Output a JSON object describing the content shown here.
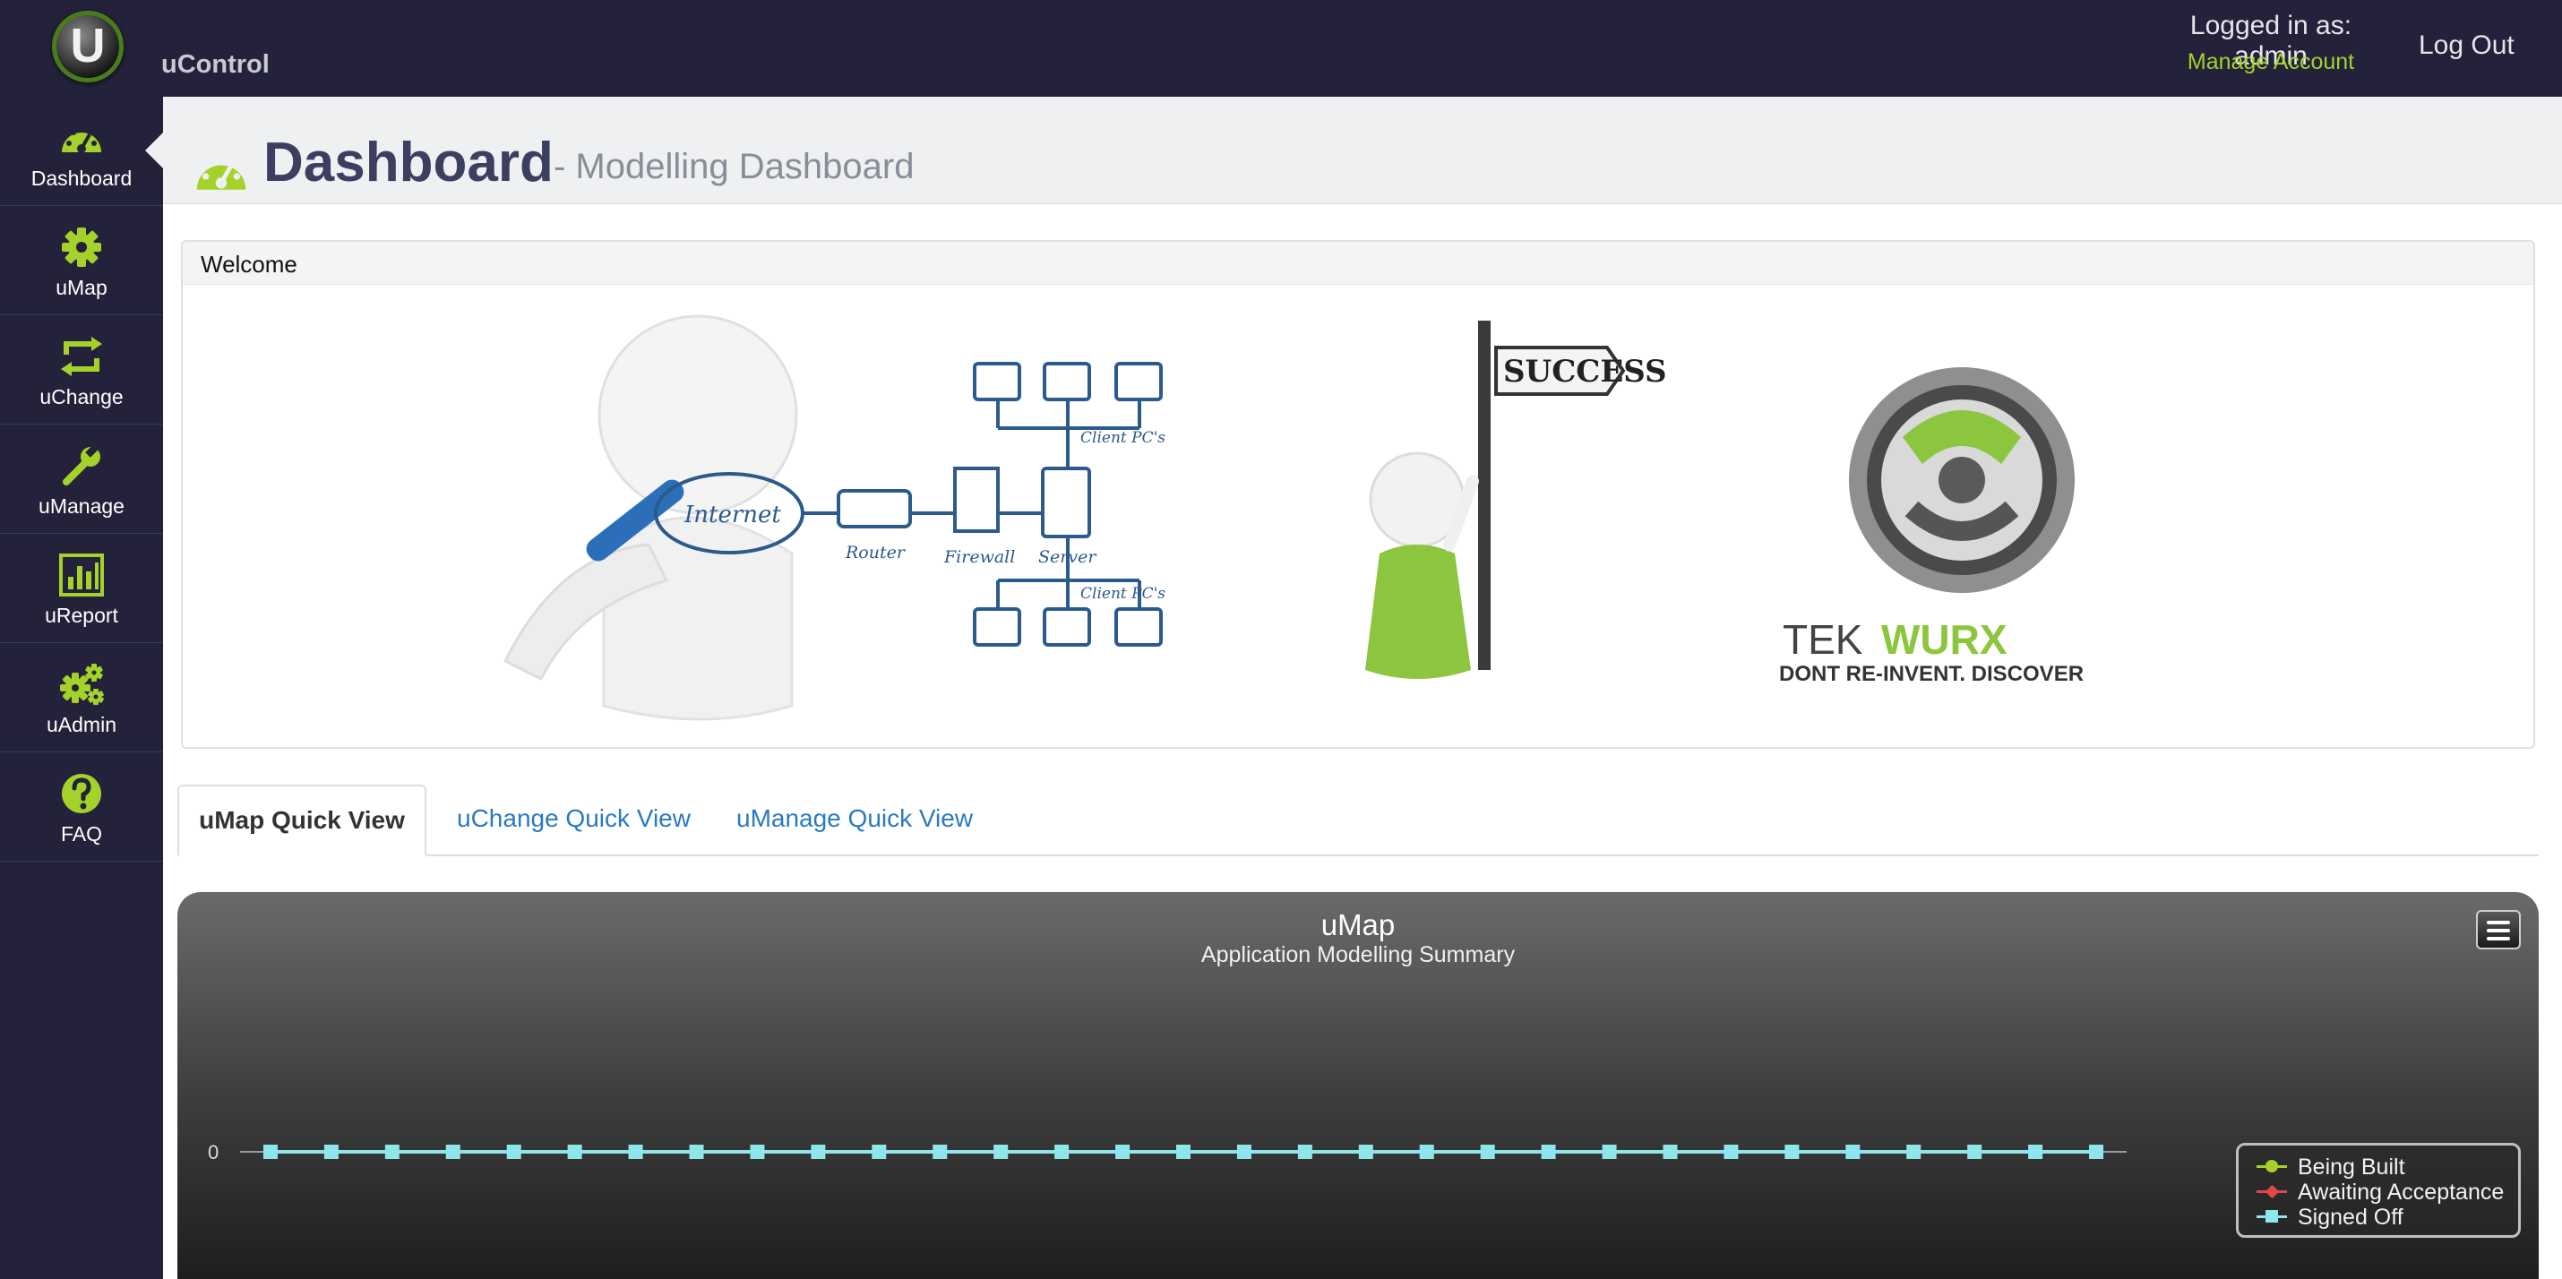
{
  "app": {
    "logo_letter": "U",
    "name": "uControl"
  },
  "user": {
    "logged_in_text": "Logged in as: admin",
    "manage_account": "Manage Account",
    "logout": "Log Out"
  },
  "nav": {
    "items": [
      {
        "label": "Dashboard",
        "icon": "dashboard-icon"
      },
      {
        "label": "uMap",
        "icon": "gear-icon"
      },
      {
        "label": "uChange",
        "icon": "retweet-icon"
      },
      {
        "label": "uManage",
        "icon": "wrench-icon"
      },
      {
        "label": "uReport",
        "icon": "bar-chart-icon"
      },
      {
        "label": "uAdmin",
        "icon": "gears-icon"
      },
      {
        "label": "FAQ",
        "icon": "question-icon"
      }
    ],
    "active": "Dashboard"
  },
  "header": {
    "title": "Dashboard",
    "subtitle": "- Modelling Dashboard"
  },
  "welcome": {
    "title": "Welcome",
    "illustration": {
      "internet": "Internet",
      "router": "Router",
      "firewall": "Firewall",
      "server": "Server",
      "client_top": "Client PC's",
      "client_bottom": "Client PC's",
      "sign": "SUCCESS",
      "brand_a": "TEK",
      "brand_b": "WURX",
      "tagline": "DONT RE-INVENT.  DISCOVER"
    }
  },
  "tabs": [
    {
      "label": "uMap Quick View",
      "active": true
    },
    {
      "label": "uChange Quick View",
      "active": false
    },
    {
      "label": "uManage Quick View",
      "active": false
    }
  ],
  "colors": {
    "accent": "#a4d22a",
    "nav_bg": "#23223a",
    "link": "#2a7ac0",
    "title": "#3d3f60"
  },
  "chart_data": {
    "type": "line",
    "title": "uMap",
    "subtitle": "Application Modelling Summary",
    "y_tick_labels": [
      "0"
    ],
    "point_count": 31,
    "series": [
      {
        "name": "Being Built",
        "color": "#a4d22a",
        "marker": "circle",
        "values": [
          0,
          0,
          0,
          0,
          0,
          0,
          0,
          0,
          0,
          0,
          0,
          0,
          0,
          0,
          0,
          0,
          0,
          0,
          0,
          0,
          0,
          0,
          0,
          0,
          0,
          0,
          0,
          0,
          0,
          0,
          0
        ]
      },
      {
        "name": "Awaiting Acceptance",
        "color": "#e04848",
        "marker": "diamond",
        "values": [
          0,
          0,
          0,
          0,
          0,
          0,
          0,
          0,
          0,
          0,
          0,
          0,
          0,
          0,
          0,
          0,
          0,
          0,
          0,
          0,
          0,
          0,
          0,
          0,
          0,
          0,
          0,
          0,
          0,
          0,
          0
        ]
      },
      {
        "name": "Signed Off",
        "color": "#8fe6ea",
        "marker": "square",
        "values": [
          0,
          0,
          0,
          0,
          0,
          0,
          0,
          0,
          0,
          0,
          0,
          0,
          0,
          0,
          0,
          0,
          0,
          0,
          0,
          0,
          0,
          0,
          0,
          0,
          0,
          0,
          0,
          0,
          0,
          0,
          0
        ]
      }
    ],
    "legend_position": "bottom-right"
  }
}
